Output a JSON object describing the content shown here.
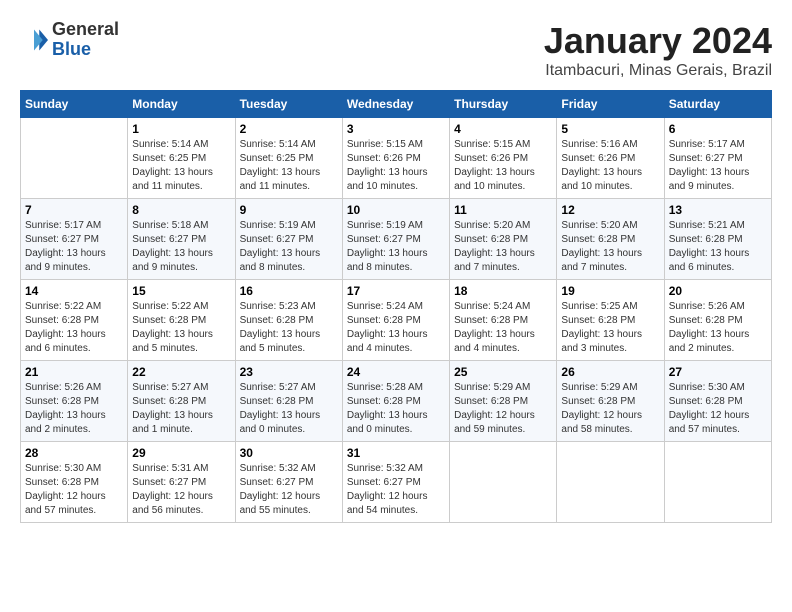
{
  "logo": {
    "general": "General",
    "blue": "Blue"
  },
  "title": "January 2024",
  "subtitle": "Itambacuri, Minas Gerais, Brazil",
  "weekdays": [
    "Sunday",
    "Monday",
    "Tuesday",
    "Wednesday",
    "Thursday",
    "Friday",
    "Saturday"
  ],
  "weeks": [
    [
      {
        "day": "",
        "info": ""
      },
      {
        "day": "1",
        "info": "Sunrise: 5:14 AM\nSunset: 6:25 PM\nDaylight: 13 hours\nand 11 minutes."
      },
      {
        "day": "2",
        "info": "Sunrise: 5:14 AM\nSunset: 6:25 PM\nDaylight: 13 hours\nand 11 minutes."
      },
      {
        "day": "3",
        "info": "Sunrise: 5:15 AM\nSunset: 6:26 PM\nDaylight: 13 hours\nand 10 minutes."
      },
      {
        "day": "4",
        "info": "Sunrise: 5:15 AM\nSunset: 6:26 PM\nDaylight: 13 hours\nand 10 minutes."
      },
      {
        "day": "5",
        "info": "Sunrise: 5:16 AM\nSunset: 6:26 PM\nDaylight: 13 hours\nand 10 minutes."
      },
      {
        "day": "6",
        "info": "Sunrise: 5:17 AM\nSunset: 6:27 PM\nDaylight: 13 hours\nand 9 minutes."
      }
    ],
    [
      {
        "day": "7",
        "info": "Sunrise: 5:17 AM\nSunset: 6:27 PM\nDaylight: 13 hours\nand 9 minutes."
      },
      {
        "day": "8",
        "info": "Sunrise: 5:18 AM\nSunset: 6:27 PM\nDaylight: 13 hours\nand 9 minutes."
      },
      {
        "day": "9",
        "info": "Sunrise: 5:19 AM\nSunset: 6:27 PM\nDaylight: 13 hours\nand 8 minutes."
      },
      {
        "day": "10",
        "info": "Sunrise: 5:19 AM\nSunset: 6:27 PM\nDaylight: 13 hours\nand 8 minutes."
      },
      {
        "day": "11",
        "info": "Sunrise: 5:20 AM\nSunset: 6:28 PM\nDaylight: 13 hours\nand 7 minutes."
      },
      {
        "day": "12",
        "info": "Sunrise: 5:20 AM\nSunset: 6:28 PM\nDaylight: 13 hours\nand 7 minutes."
      },
      {
        "day": "13",
        "info": "Sunrise: 5:21 AM\nSunset: 6:28 PM\nDaylight: 13 hours\nand 6 minutes."
      }
    ],
    [
      {
        "day": "14",
        "info": "Sunrise: 5:22 AM\nSunset: 6:28 PM\nDaylight: 13 hours\nand 6 minutes."
      },
      {
        "day": "15",
        "info": "Sunrise: 5:22 AM\nSunset: 6:28 PM\nDaylight: 13 hours\nand 5 minutes."
      },
      {
        "day": "16",
        "info": "Sunrise: 5:23 AM\nSunset: 6:28 PM\nDaylight: 13 hours\nand 5 minutes."
      },
      {
        "day": "17",
        "info": "Sunrise: 5:24 AM\nSunset: 6:28 PM\nDaylight: 13 hours\nand 4 minutes."
      },
      {
        "day": "18",
        "info": "Sunrise: 5:24 AM\nSunset: 6:28 PM\nDaylight: 13 hours\nand 4 minutes."
      },
      {
        "day": "19",
        "info": "Sunrise: 5:25 AM\nSunset: 6:28 PM\nDaylight: 13 hours\nand 3 minutes."
      },
      {
        "day": "20",
        "info": "Sunrise: 5:26 AM\nSunset: 6:28 PM\nDaylight: 13 hours\nand 2 minutes."
      }
    ],
    [
      {
        "day": "21",
        "info": "Sunrise: 5:26 AM\nSunset: 6:28 PM\nDaylight: 13 hours\nand 2 minutes."
      },
      {
        "day": "22",
        "info": "Sunrise: 5:27 AM\nSunset: 6:28 PM\nDaylight: 13 hours\nand 1 minute."
      },
      {
        "day": "23",
        "info": "Sunrise: 5:27 AM\nSunset: 6:28 PM\nDaylight: 13 hours\nand 0 minutes."
      },
      {
        "day": "24",
        "info": "Sunrise: 5:28 AM\nSunset: 6:28 PM\nDaylight: 13 hours\nand 0 minutes."
      },
      {
        "day": "25",
        "info": "Sunrise: 5:29 AM\nSunset: 6:28 PM\nDaylight: 12 hours\nand 59 minutes."
      },
      {
        "day": "26",
        "info": "Sunrise: 5:29 AM\nSunset: 6:28 PM\nDaylight: 12 hours\nand 58 minutes."
      },
      {
        "day": "27",
        "info": "Sunrise: 5:30 AM\nSunset: 6:28 PM\nDaylight: 12 hours\nand 57 minutes."
      }
    ],
    [
      {
        "day": "28",
        "info": "Sunrise: 5:30 AM\nSunset: 6:28 PM\nDaylight: 12 hours\nand 57 minutes."
      },
      {
        "day": "29",
        "info": "Sunrise: 5:31 AM\nSunset: 6:27 PM\nDaylight: 12 hours\nand 56 minutes."
      },
      {
        "day": "30",
        "info": "Sunrise: 5:32 AM\nSunset: 6:27 PM\nDaylight: 12 hours\nand 55 minutes."
      },
      {
        "day": "31",
        "info": "Sunrise: 5:32 AM\nSunset: 6:27 PM\nDaylight: 12 hours\nand 54 minutes."
      },
      {
        "day": "",
        "info": ""
      },
      {
        "day": "",
        "info": ""
      },
      {
        "day": "",
        "info": ""
      }
    ]
  ]
}
